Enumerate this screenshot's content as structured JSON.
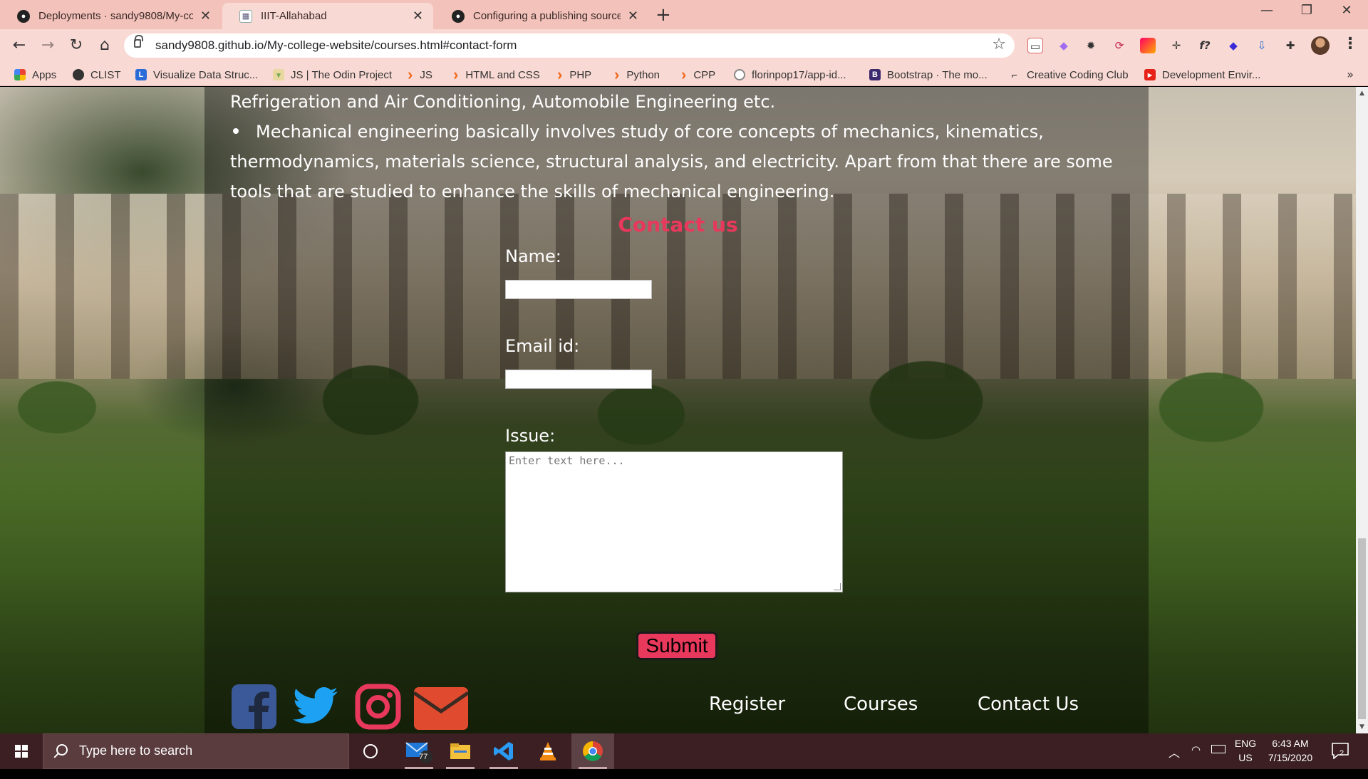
{
  "browser": {
    "tabs": [
      {
        "title": "Deployments · sandy9808/My-co",
        "icon": "github-icon",
        "active": false
      },
      {
        "title": "IIIT-Allahabad",
        "icon": "site-icon",
        "active": true
      },
      {
        "title": "Configuring a publishing source",
        "icon": "github-icon",
        "active": false
      }
    ],
    "url": "sandy9808.github.io/My-college-website/courses.html#contact-form",
    "bookmarks": [
      {
        "label": "Apps",
        "icon": "apps-grid-icon"
      },
      {
        "label": "CLIST",
        "icon": "clist-icon"
      },
      {
        "label": "Visualize Data Struc...",
        "icon": "l-icon"
      },
      {
        "label": "JS | The Odin Project",
        "icon": "odin-icon"
      },
      {
        "label": "JS",
        "icon": "folder-chevron-icon"
      },
      {
        "label": "HTML and CSS",
        "icon": "folder-chevron-icon"
      },
      {
        "label": "PHP",
        "icon": "folder-chevron-icon"
      },
      {
        "label": "Python",
        "icon": "folder-chevron-icon"
      },
      {
        "label": "CPP",
        "icon": "folder-chevron-icon"
      },
      {
        "label": "florinpop17/app-id...",
        "icon": "github-icon"
      },
      {
        "label": "Bootstrap · The mo...",
        "icon": "bootstrap-icon"
      },
      {
        "label": "Creative Coding Club",
        "icon": "ccc-icon"
      },
      {
        "label": "Development Envir...",
        "icon": "youtube-icon"
      }
    ],
    "bookmarks_more": "»"
  },
  "page": {
    "text_line1": "Refrigeration and Air Conditioning, Automobile Engineering etc.",
    "bullet": "Mechanical engineering basically involves study of core concepts of mechanics, kinematics, thermodynamics, materials science, structural analysis, and electricity. Apart from that there are some tools that are studied to enhance the skills of mechanical engineering.",
    "contact": {
      "title": "Contact us",
      "name_label": "Name:",
      "name_value": "",
      "email_label": "Email id:",
      "email_value": "",
      "issue_label": "Issue:",
      "issue_placeholder": "Enter text here...",
      "submit_label": "Submit"
    },
    "social_icons": [
      "facebook-icon",
      "twitter-icon",
      "instagram-icon",
      "mail-icon"
    ],
    "footer_links": [
      "Register",
      "Courses",
      "Contact Us"
    ],
    "colors": {
      "accent": "#e8385b",
      "facebook": "#3b5998",
      "twitter": "#1da1f2",
      "instagram": "#e8385b",
      "mail": "#e04b2f"
    }
  },
  "taskbar": {
    "search_placeholder": "Type here to search",
    "mail_badge": "77",
    "language": "ENG",
    "region": "US",
    "time": "6:43 AM",
    "date": "7/15/2020",
    "notifications": "2"
  }
}
